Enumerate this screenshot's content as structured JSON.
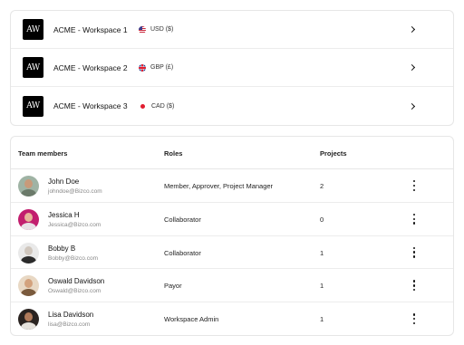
{
  "workspaces": [
    {
      "logo": "AW",
      "name": "ACME - Workspace 1",
      "currency": "USD ($)",
      "flag_icon": "us-flag-icon"
    },
    {
      "logo": "AW",
      "name": "ACME - Workspace 2",
      "currency": "GBP (£)",
      "flag_icon": "uk-flag-icon"
    },
    {
      "logo": "AW",
      "name": "ACME - Workspace 3",
      "currency": "CAD ($)",
      "flag_icon": "ca-flag-icon"
    }
  ],
  "members_table": {
    "headers": {
      "members": "Team members",
      "roles": "Roles",
      "projects": "Projects"
    },
    "rows": [
      {
        "name": "John Doe",
        "email": "johndoe@Bizco.com",
        "role": "Member, Approver, Project Manager",
        "projects": "2",
        "avatar_bg": "#9fb3a4",
        "avatar_skin": "#c89a7a",
        "avatar_shirt": "#6b7a6a"
      },
      {
        "name": "Jessica H",
        "email": "Jessica@Bizco.com",
        "role": "Collaborator",
        "projects": "0",
        "avatar_bg": "#c21e6e",
        "avatar_skin": "#e7b59a",
        "avatar_shirt": "#e8e0e6"
      },
      {
        "name": "Bobby B",
        "email": "Bobby@Bizco.com",
        "role": "Collaborator",
        "projects": "1",
        "avatar_bg": "#e9e9e9",
        "avatar_skin": "#cfc6bd",
        "avatar_shirt": "#2b2b2b"
      },
      {
        "name": "Oswald Davidson",
        "email": "Oswald@Bizco.com",
        "role": "Payor",
        "projects": "1",
        "avatar_bg": "#e8d8c4",
        "avatar_skin": "#d3a27d",
        "avatar_shirt": "#7a5a3c"
      },
      {
        "name": "Lisa Davidson",
        "email": "lisa@Bizco.com",
        "role": "Workspace Admin",
        "projects": "1",
        "avatar_bg": "#2a2320",
        "avatar_skin": "#b07a5a",
        "avatar_shirt": "#e6e2dc"
      }
    ]
  }
}
